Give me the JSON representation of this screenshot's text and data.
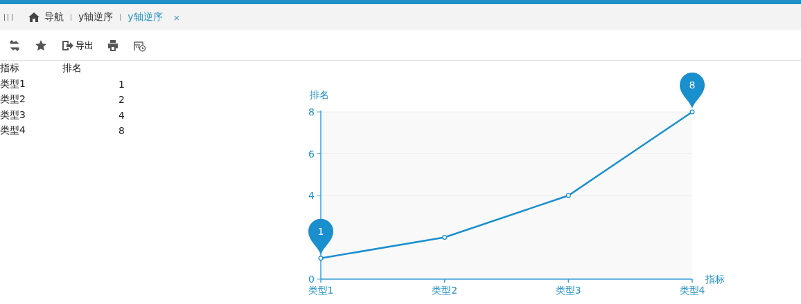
{
  "tabs": [
    {
      "kind": "home",
      "label": "导航",
      "selected": false
    },
    {
      "kind": "page",
      "label": "y轴逆序",
      "selected": false
    },
    {
      "kind": "page",
      "label": "y轴逆序",
      "selected": true,
      "close": "×"
    }
  ],
  "toolbar": [
    {
      "kind": "refresh"
    },
    {
      "kind": "star"
    },
    {
      "kind": "export",
      "label": "导出"
    },
    {
      "kind": "print"
    },
    {
      "kind": "schedule"
    }
  ],
  "table": {
    "columns": [
      "指标",
      "排名"
    ],
    "rows": [
      [
        "类型1",
        "1"
      ],
      [
        "类型2",
        "2"
      ],
      [
        "类型3",
        "4"
      ],
      [
        "类型4",
        "8"
      ]
    ]
  },
  "chart": {
    "chart_data": {
      "type": "line",
      "xlabel": "指标",
      "ylabel": "排名",
      "categories": [
        "类型1",
        "类型2",
        "类型3",
        "类型4"
      ],
      "series": [
        {
          "color": "#1a8fce",
          "marker": "circle",
          "values": [
            1,
            2,
            4,
            8
          ]
        }
      ],
      "ylim": [
        0,
        8
      ],
      "yticks": [
        0,
        4,
        6,
        8
      ],
      "annotations": [
        {
          "x": "类型1",
          "y": 1,
          "text": "1"
        },
        {
          "x": "类型4",
          "y": 8,
          "text": "8"
        }
      ]
    }
  }
}
